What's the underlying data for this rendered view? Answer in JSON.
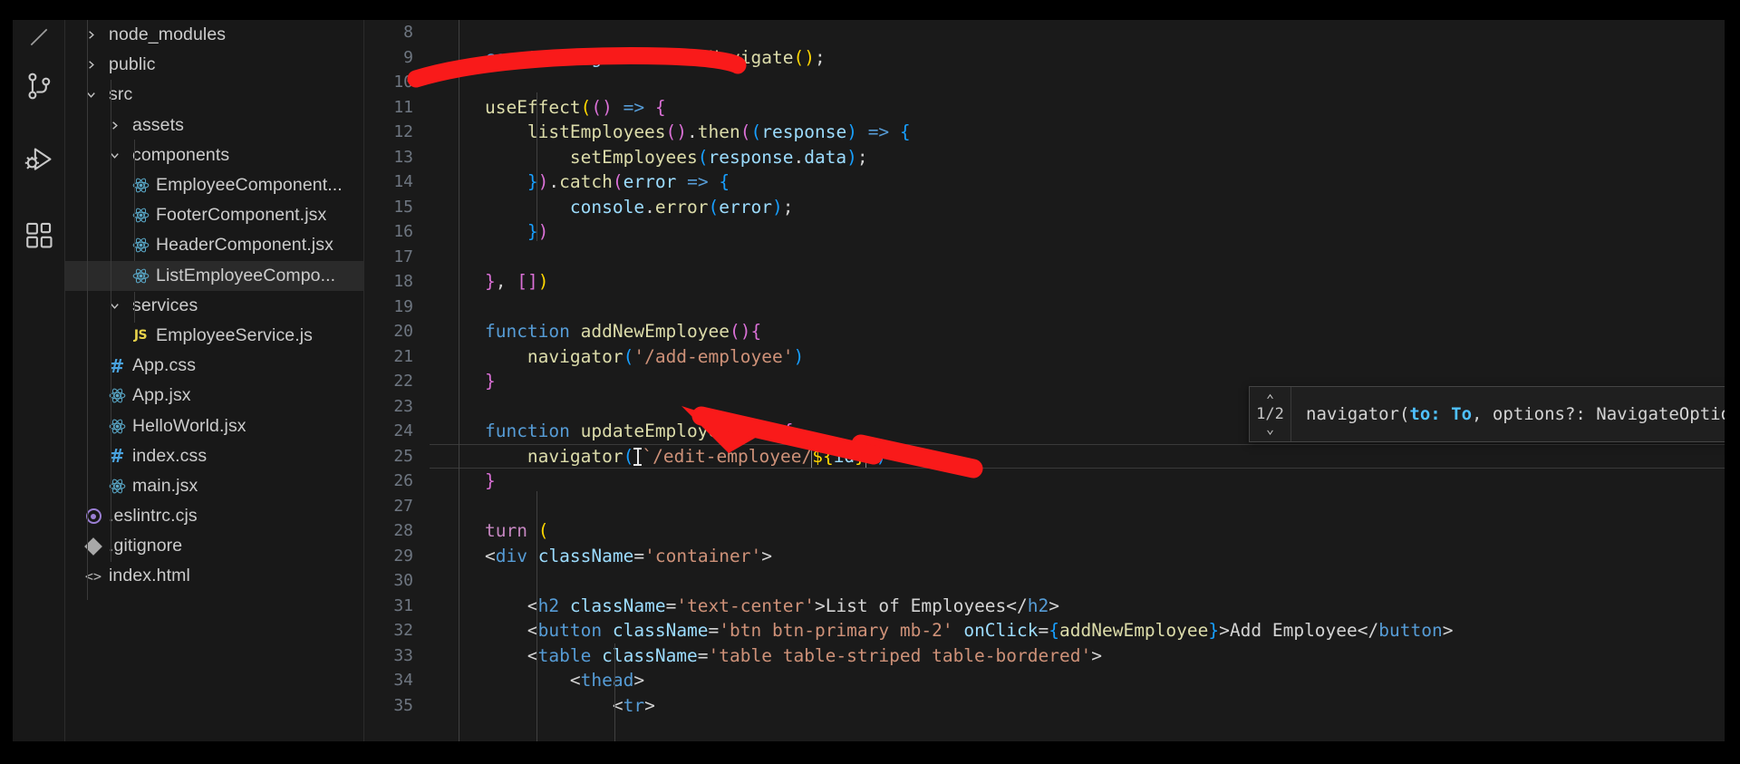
{
  "app": {
    "name": "Visual Studio Code",
    "theme": "dark-modern"
  },
  "activity_bar": {
    "items": [
      {
        "name": "explorer-icon",
        "label": "Explorer"
      },
      {
        "name": "source-control-icon",
        "label": "Source Control"
      },
      {
        "name": "run-and-debug-icon",
        "label": "Run and Debug"
      },
      {
        "name": "extensions-icon",
        "label": "Extensions"
      }
    ]
  },
  "explorer": {
    "tree": [
      {
        "label": "node_modules",
        "type": "folder",
        "state": "collapsed",
        "indent": 1,
        "icon": "chevron-right-icon"
      },
      {
        "label": "public",
        "type": "folder",
        "state": "collapsed",
        "indent": 1,
        "icon": "chevron-right-icon"
      },
      {
        "label": "src",
        "type": "folder",
        "state": "expanded",
        "indent": 1,
        "icon": "chevron-down-icon"
      },
      {
        "label": "assets",
        "type": "folder",
        "state": "collapsed",
        "indent": 2,
        "icon": "chevron-right-icon"
      },
      {
        "label": "components",
        "type": "folder",
        "state": "expanded",
        "indent": 2,
        "icon": "chevron-down-icon"
      },
      {
        "label": "EmployeeComponent...",
        "type": "file",
        "indent": 3,
        "icon": "react-icon"
      },
      {
        "label": "FooterComponent.jsx",
        "type": "file",
        "indent": 3,
        "icon": "react-icon"
      },
      {
        "label": "HeaderComponent.jsx",
        "type": "file",
        "indent": 3,
        "icon": "react-icon"
      },
      {
        "label": "ListEmployeeCompo...",
        "type": "file",
        "indent": 3,
        "icon": "react-icon",
        "selected": true
      },
      {
        "label": "services",
        "type": "folder",
        "state": "expanded",
        "indent": 2,
        "icon": "chevron-down-icon"
      },
      {
        "label": "EmployeeService.js",
        "type": "file",
        "indent": 3,
        "icon": "js-icon"
      },
      {
        "label": "App.css",
        "type": "file",
        "indent": 2,
        "icon": "css-icon"
      },
      {
        "label": "App.jsx",
        "type": "file",
        "indent": 2,
        "icon": "react-icon"
      },
      {
        "label": "HelloWorld.jsx",
        "type": "file",
        "indent": 2,
        "icon": "react-icon"
      },
      {
        "label": "index.css",
        "type": "file",
        "indent": 2,
        "icon": "css-icon"
      },
      {
        "label": "main.jsx",
        "type": "file",
        "indent": 2,
        "icon": "react-icon"
      },
      {
        "label": ".eslintrc.cjs",
        "type": "file",
        "indent": 1,
        "icon": "eslint-icon"
      },
      {
        "label": ".gitignore",
        "type": "file",
        "indent": 1,
        "icon": "git-icon"
      },
      {
        "label": "index.html",
        "type": "file",
        "indent": 1,
        "icon": "html-icon"
      }
    ]
  },
  "editor": {
    "first_visible_line": 8,
    "current_line": 25,
    "lines": [
      {
        "n": 8,
        "tokens": []
      },
      {
        "n": 9,
        "tokens": [
          {
            "t": "    ",
            "c": "t-plain"
          },
          {
            "t": "const",
            "c": "t-ctrl"
          },
          {
            "t": " ",
            "c": "t-plain"
          },
          {
            "t": "navigator",
            "c": "t-var"
          },
          {
            "t": " = ",
            "c": "t-plain"
          },
          {
            "t": "useNavigate",
            "c": "t-fn"
          },
          {
            "t": "(",
            "c": "t-paren1"
          },
          {
            "t": ")",
            "c": "t-paren1"
          },
          {
            "t": ";",
            "c": "t-plain"
          }
        ]
      },
      {
        "n": 10,
        "tokens": []
      },
      {
        "n": 11,
        "tokens": [
          {
            "t": "    ",
            "c": "t-plain"
          },
          {
            "t": "useEffect",
            "c": "t-fn"
          },
          {
            "t": "(",
            "c": "t-paren1"
          },
          {
            "t": "(",
            "c": "t-paren2"
          },
          {
            "t": ")",
            "c": "t-paren2"
          },
          {
            "t": " ",
            "c": "t-plain"
          },
          {
            "t": "=>",
            "c": "t-arrow"
          },
          {
            "t": " ",
            "c": "t-plain"
          },
          {
            "t": "{",
            "c": "t-paren2"
          }
        ]
      },
      {
        "n": 12,
        "tokens": [
          {
            "t": "        ",
            "c": "t-plain"
          },
          {
            "t": "listEmployees",
            "c": "t-fn"
          },
          {
            "t": "(",
            "c": "t-paren2"
          },
          {
            "t": ")",
            "c": "t-paren2"
          },
          {
            "t": ".",
            "c": "t-plain"
          },
          {
            "t": "then",
            "c": "t-fn"
          },
          {
            "t": "(",
            "c": "t-paren2"
          },
          {
            "t": "(",
            "c": "t-paren3"
          },
          {
            "t": "response",
            "c": "t-var"
          },
          {
            "t": ")",
            "c": "t-paren3"
          },
          {
            "t": " ",
            "c": "t-plain"
          },
          {
            "t": "=>",
            "c": "t-arrow"
          },
          {
            "t": " ",
            "c": "t-plain"
          },
          {
            "t": "{",
            "c": "t-paren3"
          }
        ]
      },
      {
        "n": 13,
        "tokens": [
          {
            "t": "            ",
            "c": "t-plain"
          },
          {
            "t": "setEmployees",
            "c": "t-fn"
          },
          {
            "t": "(",
            "c": "t-paren3"
          },
          {
            "t": "response",
            "c": "t-var"
          },
          {
            "t": ".",
            "c": "t-plain"
          },
          {
            "t": "data",
            "c": "t-prop"
          },
          {
            "t": ")",
            "c": "t-paren3"
          },
          {
            "t": ";",
            "c": "t-plain"
          }
        ]
      },
      {
        "n": 14,
        "tokens": [
          {
            "t": "        ",
            "c": "t-plain"
          },
          {
            "t": "}",
            "c": "t-paren3"
          },
          {
            "t": ")",
            "c": "t-paren2"
          },
          {
            "t": ".",
            "c": "t-plain"
          },
          {
            "t": "catch",
            "c": "t-fn"
          },
          {
            "t": "(",
            "c": "t-paren2"
          },
          {
            "t": "error",
            "c": "t-var"
          },
          {
            "t": " ",
            "c": "t-plain"
          },
          {
            "t": "=>",
            "c": "t-arrow"
          },
          {
            "t": " ",
            "c": "t-plain"
          },
          {
            "t": "{",
            "c": "t-paren3"
          }
        ]
      },
      {
        "n": 15,
        "tokens": [
          {
            "t": "            ",
            "c": "t-plain"
          },
          {
            "t": "console",
            "c": "t-var"
          },
          {
            "t": ".",
            "c": "t-plain"
          },
          {
            "t": "error",
            "c": "t-fn"
          },
          {
            "t": "(",
            "c": "t-paren3"
          },
          {
            "t": "error",
            "c": "t-var"
          },
          {
            "t": ")",
            "c": "t-paren3"
          },
          {
            "t": ";",
            "c": "t-plain"
          }
        ]
      },
      {
        "n": 16,
        "tokens": [
          {
            "t": "        ",
            "c": "t-plain"
          },
          {
            "t": "}",
            "c": "t-paren3"
          },
          {
            "t": ")",
            "c": "t-paren2"
          }
        ]
      },
      {
        "n": 17,
        "tokens": []
      },
      {
        "n": 18,
        "tokens": [
          {
            "t": "    ",
            "c": "t-plain"
          },
          {
            "t": "}",
            "c": "t-paren2"
          },
          {
            "t": ", ",
            "c": "t-plain"
          },
          {
            "t": "[",
            "c": "t-paren2"
          },
          {
            "t": "]",
            "c": "t-paren2"
          },
          {
            "t": ")",
            "c": "t-paren1"
          }
        ]
      },
      {
        "n": 19,
        "tokens": []
      },
      {
        "n": 20,
        "tokens": [
          {
            "t": "    ",
            "c": "t-plain"
          },
          {
            "t": "function",
            "c": "t-ctrl"
          },
          {
            "t": " ",
            "c": "t-plain"
          },
          {
            "t": "addNewEmployee",
            "c": "t-fn"
          },
          {
            "t": "(",
            "c": "t-paren2"
          },
          {
            "t": ")",
            "c": "t-paren2"
          },
          {
            "t": "{",
            "c": "t-paren2"
          }
        ]
      },
      {
        "n": 21,
        "tokens": [
          {
            "t": "        ",
            "c": "t-plain"
          },
          {
            "t": "navigator",
            "c": "t-fn"
          },
          {
            "t": "(",
            "c": "t-paren3"
          },
          {
            "t": "'/add-employee'",
            "c": "t-str"
          },
          {
            "t": ")",
            "c": "t-paren3"
          }
        ]
      },
      {
        "n": 22,
        "tokens": [
          {
            "t": "    ",
            "c": "t-plain"
          },
          {
            "t": "}",
            "c": "t-paren2"
          }
        ]
      },
      {
        "n": 23,
        "tokens": []
      },
      {
        "n": 24,
        "tokens": [
          {
            "t": "    ",
            "c": "t-plain"
          },
          {
            "t": "function",
            "c": "t-ctrl"
          },
          {
            "t": " ",
            "c": "t-plain"
          },
          {
            "t": "updateEmployee",
            "c": "t-fn"
          },
          {
            "t": "(",
            "c": "t-paren2"
          },
          {
            "t": "id",
            "c": "t-var"
          },
          {
            "t": ")",
            "c": "t-paren2"
          },
          {
            "t": " ",
            "c": "t-plain"
          },
          {
            "t": "{",
            "c": "t-paren2"
          }
        ]
      },
      {
        "n": 25,
        "current": true,
        "tokens": [
          {
            "t": "        ",
            "c": "t-plain"
          },
          {
            "t": "navigator",
            "c": "t-fn"
          },
          {
            "t": "(",
            "c": "t-paren3"
          },
          {
            "t": "`",
            "c": "t-str",
            "ibeam": true
          },
          {
            "t": "/edit-employee/",
            "c": "t-str"
          },
          {
            "t": "${",
            "c": "t-paren1",
            "box_open": true
          },
          {
            "t": "id",
            "c": "t-var"
          },
          {
            "t": "}",
            "c": "t-paren1",
            "box_close": true
          },
          {
            "t": "`",
            "c": "t-str"
          },
          {
            "t": ")",
            "c": "t-paren3"
          }
        ]
      },
      {
        "n": 26,
        "tokens": [
          {
            "t": "    ",
            "c": "t-plain"
          },
          {
            "t": "}",
            "c": "t-paren2"
          }
        ]
      },
      {
        "n": 27,
        "tokens": []
      },
      {
        "n": 28,
        "tokens": [
          {
            "t": "    ",
            "c": "t-plain"
          },
          {
            "t": "turn",
            "c": "t-kw"
          },
          {
            "t": " ",
            "c": "t-plain"
          },
          {
            "t": "(",
            "c": "t-paren1"
          }
        ]
      },
      {
        "n": 29,
        "tokens": [
          {
            "t": "    ",
            "c": "t-plain"
          },
          {
            "t": "<",
            "c": "t-punc"
          },
          {
            "t": "div",
            "c": "t-tag"
          },
          {
            "t": " ",
            "c": "t-plain"
          },
          {
            "t": "className",
            "c": "t-attr"
          },
          {
            "t": "=",
            "c": "t-punc"
          },
          {
            "t": "'container'",
            "c": "t-str"
          },
          {
            "t": ">",
            "c": "t-punc"
          }
        ]
      },
      {
        "n": 30,
        "tokens": []
      },
      {
        "n": 31,
        "tokens": [
          {
            "t": "        ",
            "c": "t-plain"
          },
          {
            "t": "<",
            "c": "t-punc"
          },
          {
            "t": "h2",
            "c": "t-tag"
          },
          {
            "t": " ",
            "c": "t-plain"
          },
          {
            "t": "className",
            "c": "t-attr"
          },
          {
            "t": "=",
            "c": "t-punc"
          },
          {
            "t": "'text-center'",
            "c": "t-str"
          },
          {
            "t": ">",
            "c": "t-punc"
          },
          {
            "t": "List of Employees",
            "c": "t-plain"
          },
          {
            "t": "</",
            "c": "t-punc"
          },
          {
            "t": "h2",
            "c": "t-tag"
          },
          {
            "t": ">",
            "c": "t-punc"
          }
        ]
      },
      {
        "n": 32,
        "tokens": [
          {
            "t": "        ",
            "c": "t-plain"
          },
          {
            "t": "<",
            "c": "t-punc"
          },
          {
            "t": "button",
            "c": "t-tag"
          },
          {
            "t": " ",
            "c": "t-plain"
          },
          {
            "t": "className",
            "c": "t-attr"
          },
          {
            "t": "=",
            "c": "t-punc"
          },
          {
            "t": "'btn btn-primary mb-2'",
            "c": "t-str"
          },
          {
            "t": " ",
            "c": "t-plain"
          },
          {
            "t": "onClick",
            "c": "t-attr"
          },
          {
            "t": "=",
            "c": "t-punc"
          },
          {
            "t": "{",
            "c": "t-paren3"
          },
          {
            "t": "addNewEmployee",
            "c": "t-fn"
          },
          {
            "t": "}",
            "c": "t-paren3"
          },
          {
            "t": ">",
            "c": "t-punc"
          },
          {
            "t": "Add Employee",
            "c": "t-plain"
          },
          {
            "t": "</",
            "c": "t-punc"
          },
          {
            "t": "button",
            "c": "t-tag"
          },
          {
            "t": ">",
            "c": "t-punc"
          }
        ]
      },
      {
        "n": 33,
        "tokens": [
          {
            "t": "        ",
            "c": "t-plain"
          },
          {
            "t": "<",
            "c": "t-punc"
          },
          {
            "t": "table",
            "c": "t-tag"
          },
          {
            "t": " ",
            "c": "t-plain"
          },
          {
            "t": "className",
            "c": "t-attr"
          },
          {
            "t": "=",
            "c": "t-punc"
          },
          {
            "t": "'table table-striped table-bordered'",
            "c": "t-str"
          },
          {
            "t": ">",
            "c": "t-punc"
          }
        ]
      },
      {
        "n": 34,
        "tokens": [
          {
            "t": "            ",
            "c": "t-plain"
          },
          {
            "t": "<",
            "c": "t-punc"
          },
          {
            "t": "thead",
            "c": "t-tag"
          },
          {
            "t": ">",
            "c": "t-punc"
          }
        ]
      },
      {
        "n": 35,
        "tokens": [
          {
            "t": "                ",
            "c": "t-plain"
          },
          {
            "t": "<",
            "c": "t-punc"
          },
          {
            "t": "tr",
            "c": "t-tag"
          },
          {
            "t": ">",
            "c": "t-punc"
          }
        ]
      }
    ]
  },
  "signature_help": {
    "prefix": "navigator(",
    "active_param": "to: To",
    "suffix": ", options?: NavigateOptions | undefined): void",
    "counter": "1/2",
    "up_arrow": "⌃",
    "down_arrow": "⌄"
  },
  "annotations": {
    "color": "#f91a1a",
    "marks": [
      {
        "name": "underline-stroke",
        "target_line": 10
      },
      {
        "name": "arrow-to-template-literal",
        "target_line": 25
      }
    ]
  }
}
